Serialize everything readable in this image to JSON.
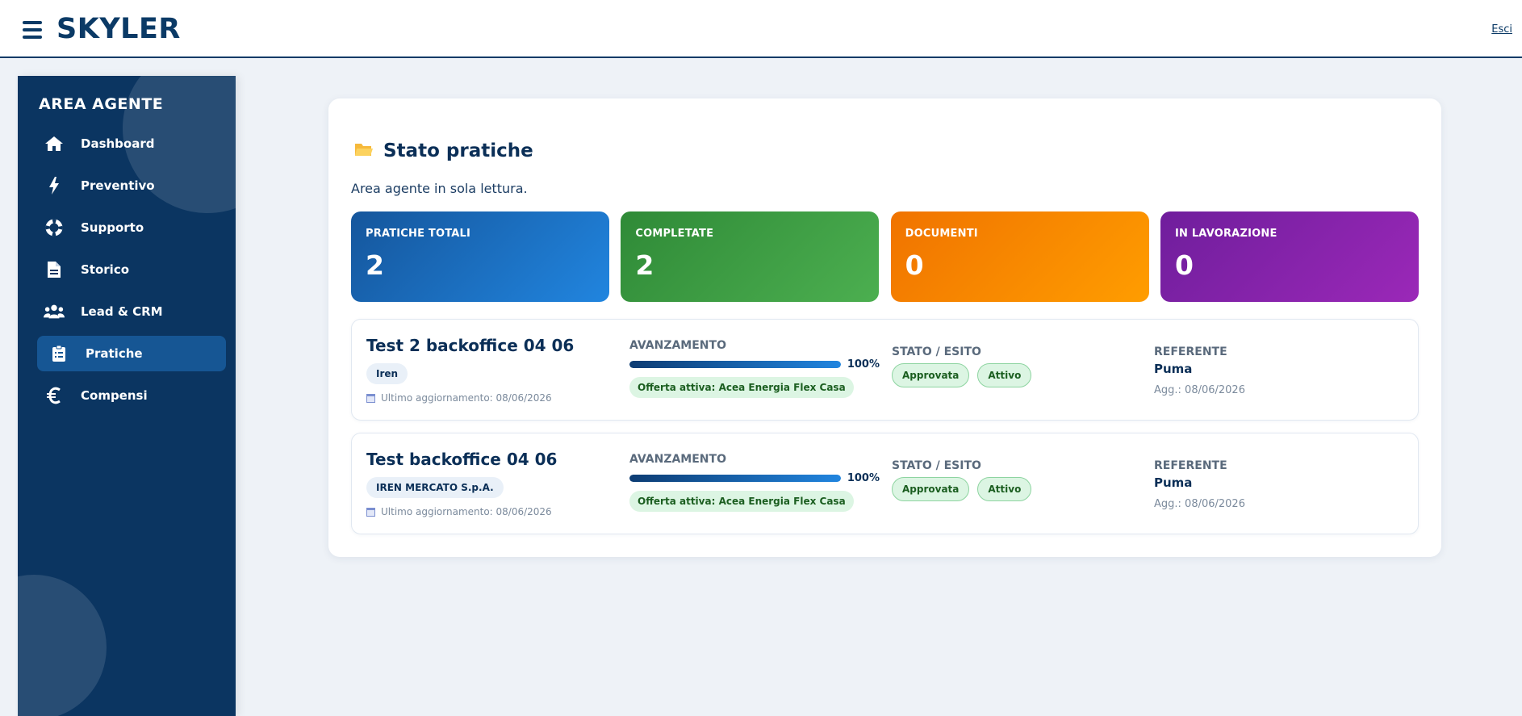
{
  "header": {
    "brand": "SKYLER",
    "logout_label": "Esci"
  },
  "sidebar": {
    "title": "AREA AGENTE",
    "items": [
      {
        "label": "Dashboard",
        "icon": "home-icon"
      },
      {
        "label": "Preventivo",
        "icon": "bolt-icon"
      },
      {
        "label": "Supporto",
        "icon": "lifebuoy-icon"
      },
      {
        "label": "Storico",
        "icon": "document-icon"
      },
      {
        "label": "Lead & CRM",
        "icon": "users-icon"
      },
      {
        "label": "Pratiche",
        "icon": "clipboard-icon",
        "active": true
      },
      {
        "label": "Compensi",
        "icon": "euro-icon"
      }
    ]
  },
  "main": {
    "title": "Stato pratiche",
    "title_icon": "folder-icon",
    "subtitle": "Area agente in sola lettura.",
    "stats": [
      {
        "label": "PRATICHE TOTALI",
        "value": "2",
        "color": "#1e73c8"
      },
      {
        "label": "COMPLETATE",
        "value": "2",
        "color": "#43a047"
      },
      {
        "label": "DOCUMENTI",
        "value": "0",
        "color": "#fb8c00"
      },
      {
        "label": "IN LAVORAZIONE",
        "value": "0",
        "color": "#8e24aa"
      }
    ],
    "columns": {
      "progress": "AVANZAMENTO",
      "status": "STATO / ESITO",
      "referent": "REFERENTE"
    },
    "practices": [
      {
        "title": "Test 2 backoffice 04 06",
        "supplier": "Iren",
        "updated": "Ultimo aggiornamento: 08/06/2026",
        "progress_percent": 100,
        "progress_label": "100%",
        "offer": "Offerta attiva: Acea Energia Flex Casa",
        "status": "Approvata",
        "outcome": "Attivo",
        "referent": "Puma",
        "referent_updated": "Agg.: 08/06/2026"
      },
      {
        "title": "Test backoffice 04 06",
        "supplier": "IREN MERCATO S.p.A.",
        "updated": "Ultimo aggiornamento: 08/06/2026",
        "progress_percent": 100,
        "progress_label": "100%",
        "offer": "Offerta attiva: Acea Energia Flex Casa",
        "status": "Approvata",
        "outcome": "Attivo",
        "referent": "Puma",
        "referent_updated": "Agg.: 08/06/2026"
      }
    ]
  }
}
